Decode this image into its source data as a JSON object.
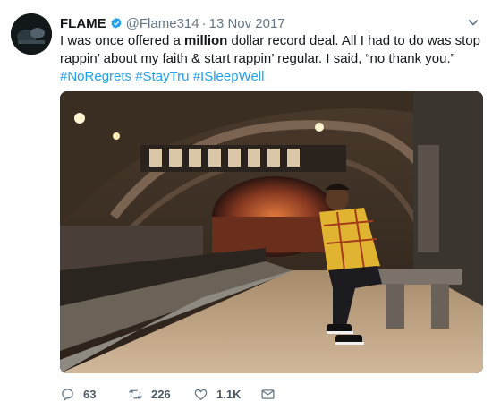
{
  "author": {
    "name": "FLAME",
    "handle": "@Flame314",
    "separator": "·",
    "date": "13 Nov 2017"
  },
  "tweet": {
    "text_part1": "I was once offered a ",
    "text_bold": "million",
    "text_part2": " dollar record deal. All I had to do was stop rappin’ about my faith & start rappin’ regular. I said, “no thank you.” ",
    "hashtags": [
      "#NoRegrets",
      "#StayTru",
      "#ISleepWell"
    ]
  },
  "stats": {
    "replies": "63",
    "retweets": "226",
    "likes": "1.1K"
  },
  "colors": {
    "link": "#1da1f2",
    "verified": "#1da1f2",
    "secondary_text": "#657786"
  },
  "icons": [
    "verified-badge-icon",
    "chevron-down-icon",
    "reply-icon",
    "retweet-icon",
    "like-icon",
    "direct-message-icon"
  ]
}
